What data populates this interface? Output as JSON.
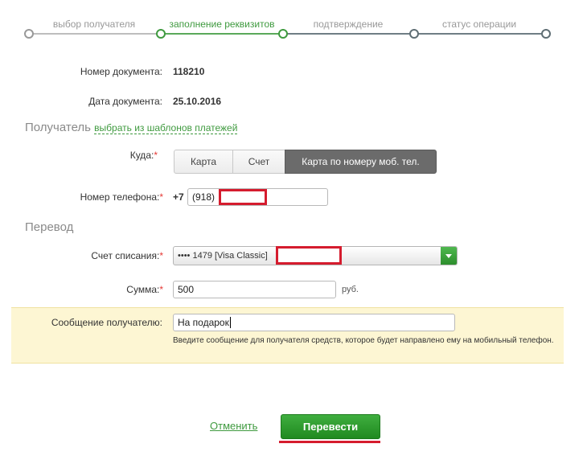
{
  "steps": [
    {
      "label": "выбор получателя",
      "state": "done"
    },
    {
      "label": "заполнение реквизитов",
      "state": "active"
    },
    {
      "label": "подтверждение",
      "state": "pending"
    },
    {
      "label": "статус операции",
      "state": "pending"
    }
  ],
  "document": {
    "number_label": "Номер документа:",
    "number_value": "118210",
    "date_label": "Дата документа:",
    "date_value": "25.10.2016"
  },
  "recipient": {
    "section_title": "Получатель",
    "template_link": "выбрать из шаблонов платежей",
    "where_label": "Куда:",
    "required_mark": "*",
    "options": [
      "Карта",
      "Счет",
      "Карта по номеру моб. тел."
    ],
    "selected_option": "Карта по номеру моб. тел.",
    "phone_label": "Номер телефона:",
    "phone_prefix": "+7",
    "phone_code": "(918)"
  },
  "transfer": {
    "section_title": "Перевод",
    "account_label": "Счет списания:",
    "account_value": "•••• 1479  [Visa Classic]",
    "amount_label": "Сумма:",
    "amount_value": "500",
    "currency": "руб.",
    "message_label": "Сообщение получателю:",
    "message_value": "На подарок",
    "message_hint": "Введите сообщение для получателя средств, которое будет направлено ему на мобильный телефон."
  },
  "actions": {
    "cancel_label": "Отменить",
    "submit_label": "Перевести"
  },
  "colors": {
    "accent_green": "#3f9a3f",
    "highlight_red": "#d51c2e",
    "message_row_bg": "#fdf6d3"
  }
}
